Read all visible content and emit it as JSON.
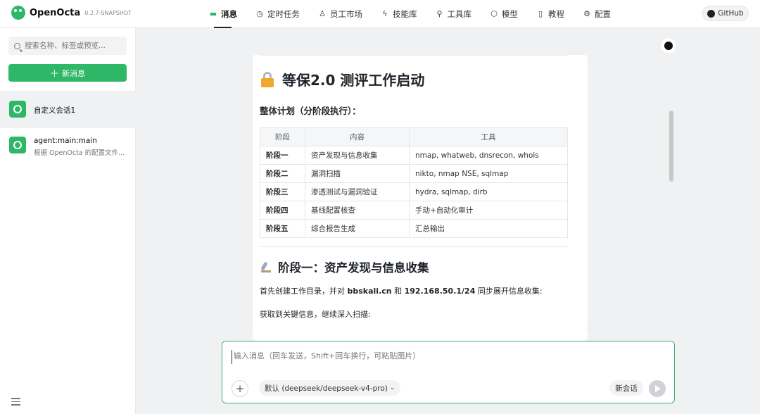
{
  "app": {
    "name": "OpenOcta",
    "version": "0.2.7-SNAPSHOT",
    "github_label": "GitHub"
  },
  "nav": [
    {
      "label": "消息",
      "icon": "message-icon",
      "active": true
    },
    {
      "label": "定时任务",
      "icon": "clock-icon"
    },
    {
      "label": "员工市场",
      "icon": "user-icon"
    },
    {
      "label": "技能库",
      "icon": "lightning-icon"
    },
    {
      "label": "工具库",
      "icon": "wrench-icon"
    },
    {
      "label": "模型",
      "icon": "cube-icon"
    },
    {
      "label": "教程",
      "icon": "book-icon"
    },
    {
      "label": "配置",
      "icon": "gear-icon"
    }
  ],
  "sidebar": {
    "search_placeholder": "搜索名称、标签或预览...",
    "new_button": "新消息",
    "conversations": [
      {
        "title": "自定义会话1",
        "subtitle": ""
      },
      {
        "title": "agent:main:main",
        "subtitle": "根据 OpenOcta 的配置文件..."
      }
    ]
  },
  "message": {
    "heading": "等保2.0 测评工作启动",
    "plan_title": "整体计划（分阶段执行）：",
    "table": {
      "headers": [
        "阶段",
        "内容",
        "工具"
      ],
      "rows": [
        [
          "阶段一",
          "资产发现与信息收集",
          "nmap, whatweb, dnsrecon, whois"
        ],
        [
          "阶段二",
          "漏洞扫描",
          "nikto, nmap NSE, sqlmap"
        ],
        [
          "阶段三",
          "渗透测试与漏洞验证",
          "hydra, sqlmap, dirb"
        ],
        [
          "阶段四",
          "基线配置核查",
          "手动+自动化审计"
        ],
        [
          "阶段五",
          "综合报告生成",
          "汇总输出"
        ]
      ]
    },
    "section_heading": "阶段一：资产发现与信息收集",
    "para_prefix": "首先创建工作目录，并对 ",
    "para_domain": "bbskali.cn",
    "para_mid": " 和 ",
    "para_ip": "192.168.50.1/24",
    "para_suffix": " 同步展开信息收集:",
    "followup": "获取到关键信息，继续深入扫描:"
  },
  "composer": {
    "placeholder": "输入消息（回车发送，Shift+回车换行，可粘贴图片）",
    "model_label": "默认 (deepseek/deepseek-v4-pro)",
    "new_session": "新会话"
  }
}
